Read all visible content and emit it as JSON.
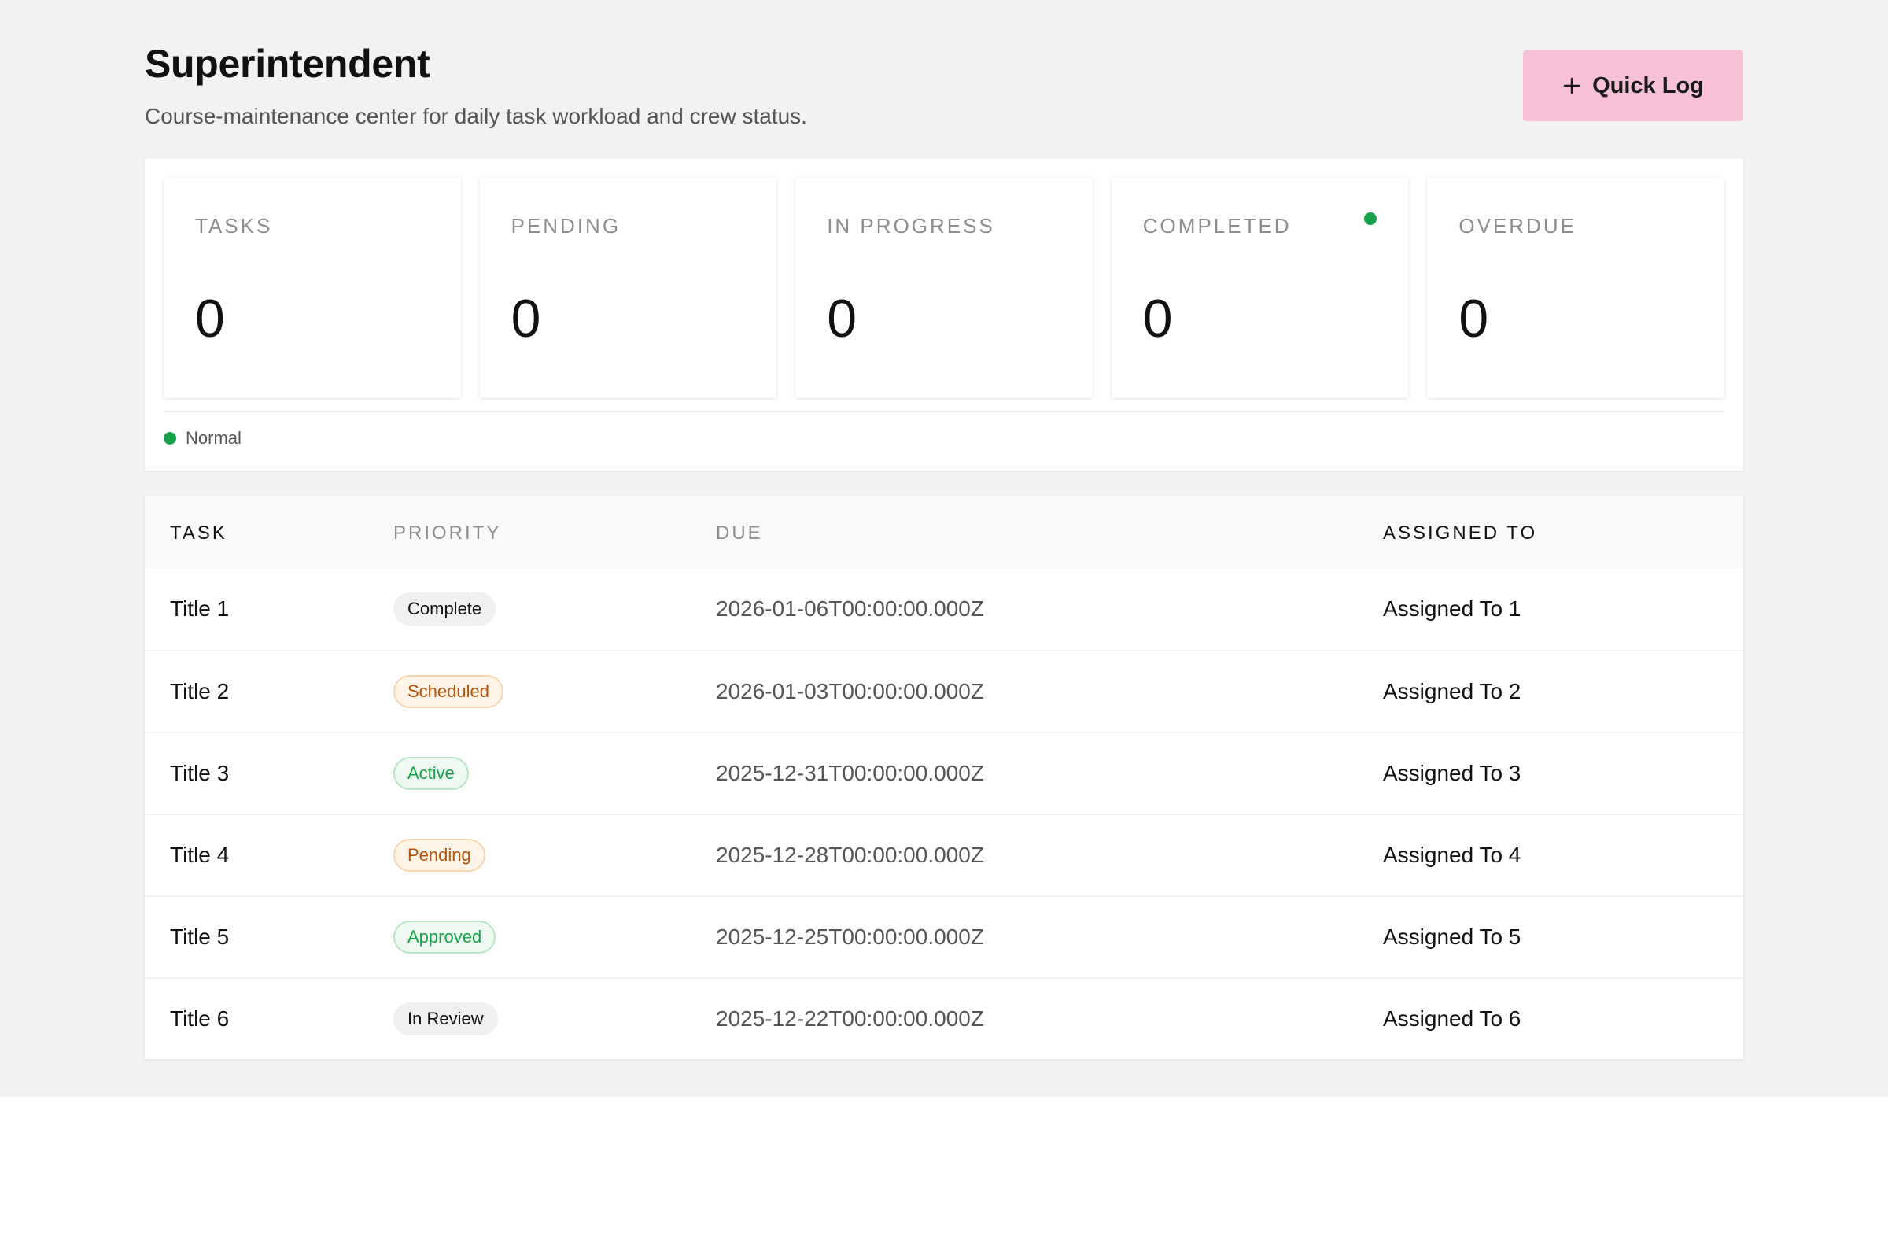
{
  "header": {
    "title": "Superintendent",
    "subtitle": "Course-maintenance center for daily task workload and crew status.",
    "quick_log_label": "Quick Log",
    "quick_log_icon": "plus-icon"
  },
  "colors": {
    "accent_button": "#f6c0d6",
    "status_green": "#16a34a",
    "warn_orange": "#b45309"
  },
  "stats": [
    {
      "label": "TASKS",
      "value": "0"
    },
    {
      "label": "PENDING",
      "value": "0"
    },
    {
      "label": "IN PROGRESS",
      "value": "0"
    },
    {
      "label": "COMPLETED",
      "value": "0",
      "indicator": "green-dot"
    },
    {
      "label": "OVERDUE",
      "value": "0"
    }
  ],
  "legend": {
    "label": "Normal",
    "color": "#16a34a"
  },
  "table": {
    "columns": [
      "TASK",
      "PRIORITY",
      "DUE",
      "ASSIGNED TO"
    ],
    "rows": [
      {
        "task": "Title 1",
        "priority": "Complete",
        "priority_style": "neutral",
        "due": "2026-01-06T00:00:00.000Z",
        "assigned": "Assigned To 1"
      },
      {
        "task": "Title 2",
        "priority": "Scheduled",
        "priority_style": "warn",
        "due": "2026-01-03T00:00:00.000Z",
        "assigned": "Assigned To 2"
      },
      {
        "task": "Title 3",
        "priority": "Active",
        "priority_style": "success",
        "due": "2025-12-31T00:00:00.000Z",
        "assigned": "Assigned To 3"
      },
      {
        "task": "Title 4",
        "priority": "Pending",
        "priority_style": "warn",
        "due": "2025-12-28T00:00:00.000Z",
        "assigned": "Assigned To 4"
      },
      {
        "task": "Title 5",
        "priority": "Approved",
        "priority_style": "success",
        "due": "2025-12-25T00:00:00.000Z",
        "assigned": "Assigned To 5"
      },
      {
        "task": "Title 6",
        "priority": "In Review",
        "priority_style": "neutral",
        "due": "2025-12-22T00:00:00.000Z",
        "assigned": "Assigned To 6"
      }
    ]
  }
}
